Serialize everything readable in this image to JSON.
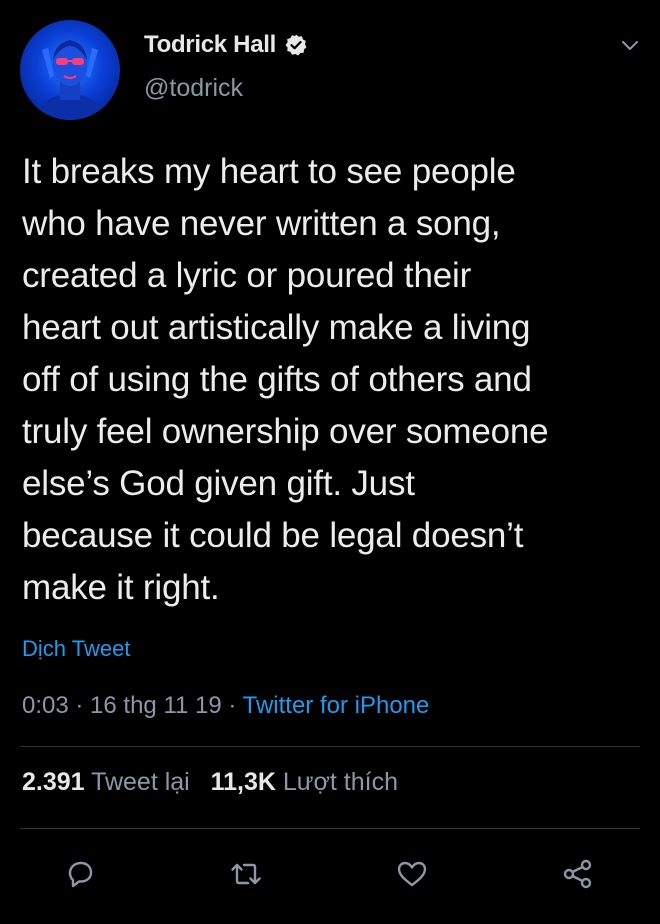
{
  "author": {
    "display_name": "Todrick Hall",
    "handle": "@todrick",
    "verified": true
  },
  "tweet": {
    "text": "It breaks my heart to see people\nwho have never written a song,\ncreated a lyric or poured their\nheart out artistically make a living\noff of using the gifts of others and\ntruly feel ownership over someone\nelse’s God given gift. Just\nbecause it could be legal doesn’t\nmake it right.",
    "translate_label": "Dịch Tweet",
    "time": "0:03",
    "date": "16 thg 11 19",
    "separator": " · ",
    "source": "Twitter for iPhone"
  },
  "stats": {
    "retweets_count": "2.391",
    "retweets_label": "Tweet lại",
    "likes_count": "11,3K",
    "likes_label": "Lượt thích"
  },
  "actions": [
    {
      "name": "reply-icon"
    },
    {
      "name": "retweet-icon"
    },
    {
      "name": "like-icon"
    },
    {
      "name": "share-icon"
    }
  ],
  "colors": {
    "background": "#000000",
    "accent": "#1d9bf0",
    "secondary_text": "#8b98a5",
    "divider": "#2f3336"
  }
}
